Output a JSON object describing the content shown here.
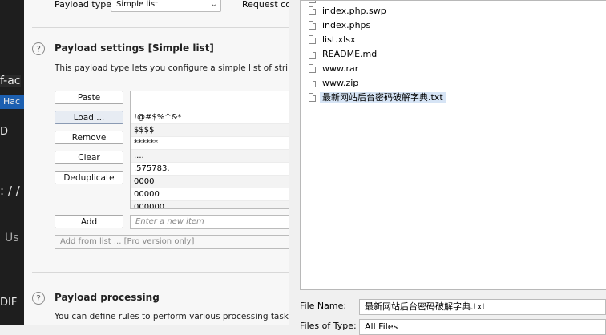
{
  "background_window": {
    "fragments": [
      "f-ac",
      "Hac",
      "D",
      ": / /",
      "Us",
      "DIF"
    ]
  },
  "burp": {
    "payload_type_label": "Payload type:",
    "payload_type_value": "Simple list",
    "request_count_label": "Request co",
    "settings": {
      "help": "?",
      "title": "Payload settings [Simple list]",
      "description": "This payload type lets you configure a simple list of strings th",
      "buttons": {
        "paste": "Paste",
        "load": "Load ...",
        "remove": "Remove",
        "clear": "Clear",
        "deduplicate": "Deduplicate",
        "add": "Add"
      },
      "list_items": [
        "!@#$%^&*",
        "$$$$",
        "******",
        "....",
        ".575783.",
        "0000",
        "00000",
        "000000"
      ],
      "new_item_placeholder": "Enter a new item",
      "add_from_list": "Add from list ... [Pro version only]"
    },
    "processing": {
      "help": "?",
      "title": "Payload processing",
      "description": "You can define rules to perform various processing tasks on e"
    }
  },
  "file_chooser": {
    "files": [
      {
        "name": "index.php.swp",
        "selected": false
      },
      {
        "name": "index.phps",
        "selected": false
      },
      {
        "name": "list.xlsx",
        "selected": false
      },
      {
        "name": "README.md",
        "selected": false
      },
      {
        "name": "www.rar",
        "selected": false
      },
      {
        "name": "www.zip",
        "selected": false
      },
      {
        "name": "最新网站后台密码破解字典.txt",
        "selected": true
      }
    ],
    "file_name_label": "File Name:",
    "file_name_value": "最新网站后台密码破解字典.txt",
    "files_of_type_label": "Files of Type:",
    "files_of_type_value": "All Files"
  }
}
